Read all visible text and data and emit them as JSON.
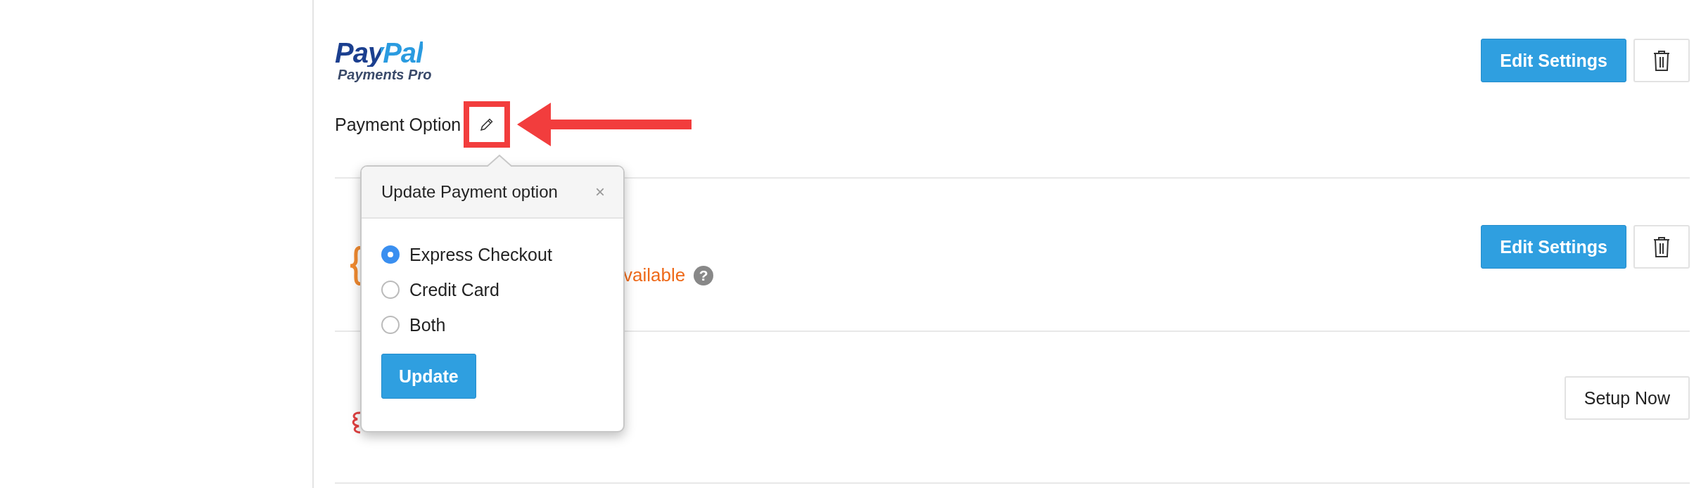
{
  "gateways": [
    {
      "logo": {
        "kind": "paypal",
        "wordmark": "PayPal",
        "subtitle": "Payments Pro"
      },
      "field": {
        "label": "Payment Option",
        "highlighted": true
      },
      "actions": [
        {
          "kind": "primary",
          "label": "Edit Settings"
        },
        {
          "kind": "delete"
        }
      ]
    },
    {
      "logo": {
        "kind": "brace"
      },
      "status": {
        "text": "vailable",
        "help": "?"
      },
      "actions": [
        {
          "kind": "primary",
          "label": "Edit Settings"
        },
        {
          "kind": "delete"
        }
      ]
    },
    {
      "logo": {
        "kind": "swirl"
      },
      "actions": [
        {
          "kind": "plain",
          "label": "Setup Now"
        }
      ]
    }
  ],
  "popover": {
    "title": "Update Payment option",
    "close": "×",
    "options": [
      {
        "label": "Express Checkout",
        "selected": true
      },
      {
        "label": "Credit Card",
        "selected": false
      },
      {
        "label": "Both",
        "selected": false
      }
    ],
    "submit": "Update"
  }
}
